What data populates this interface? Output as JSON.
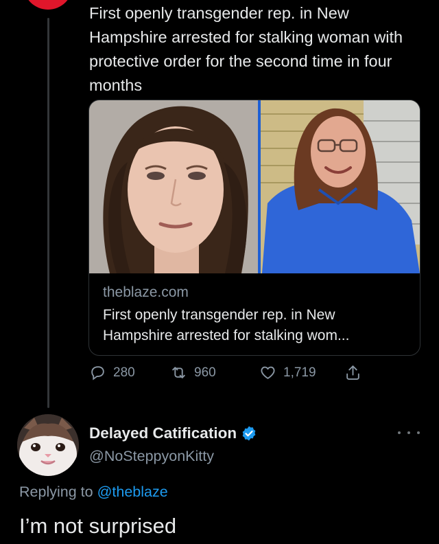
{
  "tweet": {
    "text": "First openly transgender rep. in New Hampshire arrested for stalking woman with protective order for the second time in four months",
    "card": {
      "domain": "theblaze.com",
      "title": "First openly transgender rep. in New Hampshire arrested for stalking wom..."
    },
    "stats": {
      "replies": "280",
      "retweets": "960",
      "likes": "1,719"
    }
  },
  "reply": {
    "display_name": "Delayed Catification",
    "handle": "@NoSteppyonKitty",
    "replying_prefix": "Replying to",
    "replying_to": "@theblaze",
    "text": "I’m not surprised"
  },
  "icons": {
    "reply": "speech-bubble-icon",
    "retweet": "retweet-arrows-icon",
    "like": "heart-icon",
    "share": "share-upload-icon",
    "verified": "verified-badge-icon",
    "more": "more-dots-icon"
  },
  "colors": {
    "background": "#000000",
    "text": "#e7e9ea",
    "secondary_text": "#8b98a5",
    "link": "#1d9bf0",
    "verified_badge": "#1d9bf0",
    "top_avatar": "#e0162b"
  }
}
